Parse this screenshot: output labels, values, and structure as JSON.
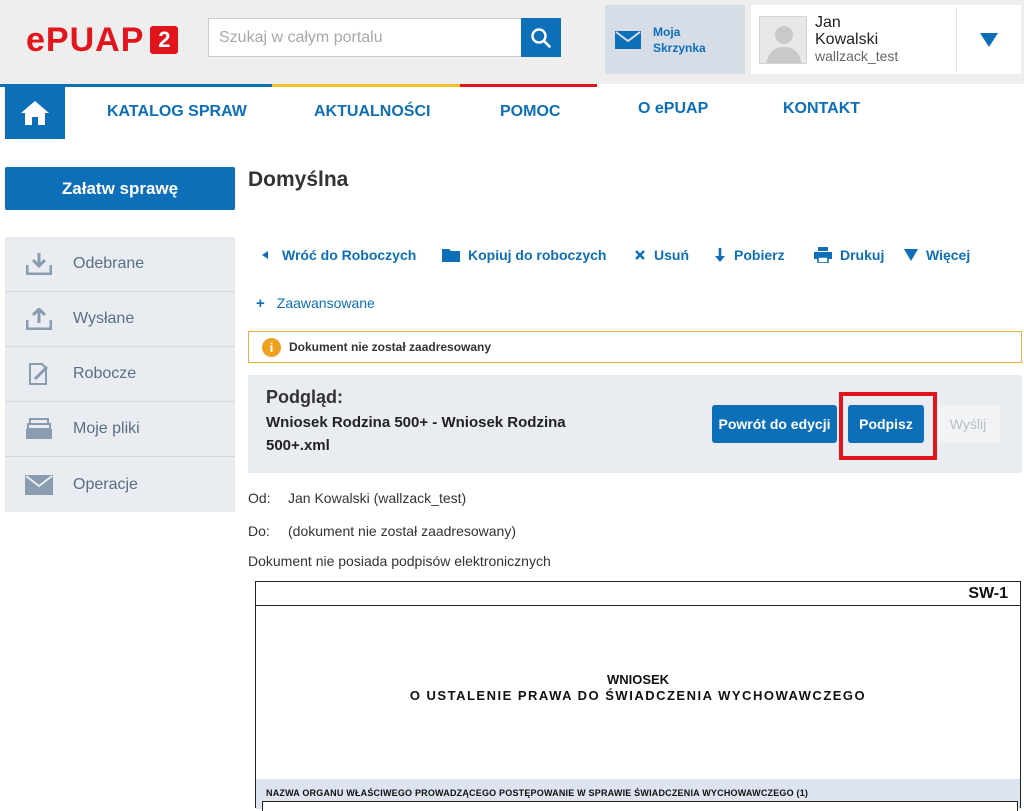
{
  "header": {
    "logo_text": "ePUAP",
    "logo_number": "2",
    "search": {
      "placeholder": "Szukaj w całym portalu"
    },
    "inbox": {
      "line1": "Moja",
      "line2": "Skrzynka"
    },
    "user": {
      "first_name": "Jan",
      "last_name": "Kowalski",
      "login": "wallzack_test"
    }
  },
  "nav": {
    "color_bar": [
      "#0d6fb8",
      "#f2c12e",
      "#e2141c"
    ],
    "items": [
      {
        "label": "KATALOG SPRAW"
      },
      {
        "label": "AKTUALNOŚCI"
      },
      {
        "label": "POMOC"
      },
      {
        "label": "O ePUAP"
      },
      {
        "label": "KONTAKT"
      }
    ]
  },
  "sidebar": {
    "primary_button": "Załatw sprawę",
    "items": [
      {
        "label": "Odebrane",
        "icon": "inbox-download-icon"
      },
      {
        "label": "Wysłane",
        "icon": "outbox-upload-icon"
      },
      {
        "label": "Robocze",
        "icon": "draft-edit-icon"
      },
      {
        "label": "Moje pliki",
        "icon": "files-stack-icon"
      },
      {
        "label": "Operacje",
        "icon": "envelope-icon"
      }
    ]
  },
  "main": {
    "title": "Domyślna",
    "toolbar": {
      "back": "Wróć do Roboczych",
      "copy": "Kopiuj do roboczych",
      "delete": "Usuń",
      "download": "Pobierz",
      "print": "Drukuj",
      "more": "Więcej"
    },
    "advanced": "Zaawansowane",
    "warning": "Dokument nie został zaadresowany",
    "preview": {
      "label": "Podgląd:",
      "name": "Wniosek Rodzina 500+ - Wniosek Rodzina 500+.xml",
      "btn_back": "Powrót do edycji",
      "btn_sign": "Podpisz",
      "btn_send": "Wyślij"
    },
    "from": {
      "label": "Od:",
      "value": "Jan Kowalski (wallzack_test)"
    },
    "to": {
      "label": "Do:",
      "value": "(dokument nie został zaadresowany)"
    },
    "signatures": "Dokument nie posiada podpisów elektronicznych"
  },
  "document": {
    "code": "SW-1",
    "title_line1": "WNIOSEK",
    "title_line2": "O USTALENIE PRAWA DO ŚWIADCZENIA WYCHOWAWCZEGO",
    "section1": "NAZWA ORGANU WŁAŚCIWEGO PROWADZĄCEGO POSTĘPOWANIE W SPRAWIE ŚWIADCZENIA WYCHOWAWCZEGO (1)"
  },
  "colors": {
    "brand_red": "#e2141c",
    "accent_blue": "#0d6fb8",
    "warning_orange": "#f0a020",
    "highlight_red": "#e2141c"
  }
}
